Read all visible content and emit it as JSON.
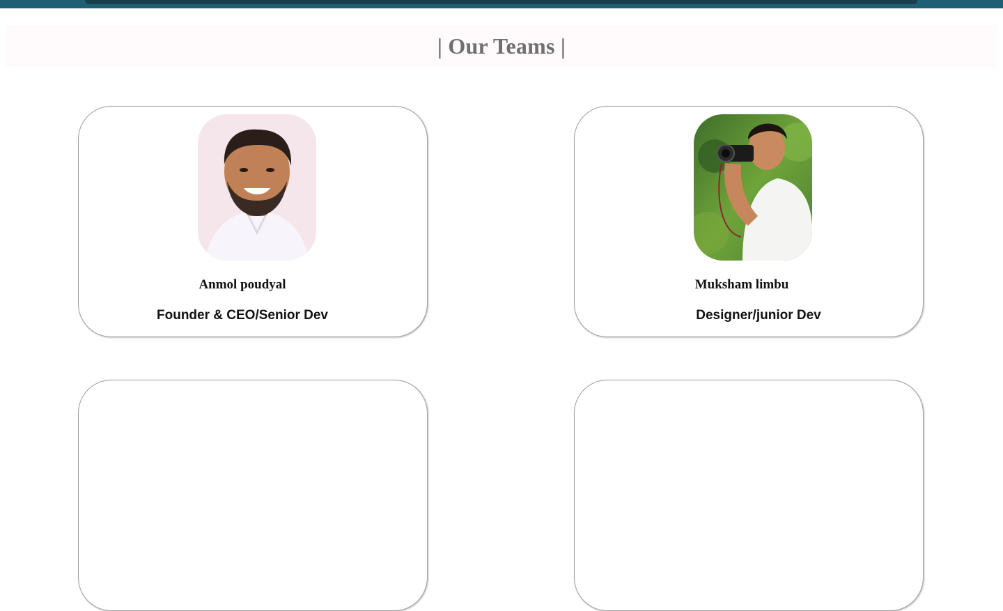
{
  "section": {
    "title": "| Our Teams |"
  },
  "members": [
    {
      "name": "Anmol poudyal",
      "role": "Founder & CEO/Senior Dev"
    },
    {
      "name": "Muksham limbu",
      "role": "Designer/junior Dev"
    }
  ],
  "colors": {
    "topbar": "#1f5f73",
    "header_bg": "#fffafb",
    "title": "#6f6f6f",
    "card_border": "#9e9e9e"
  }
}
